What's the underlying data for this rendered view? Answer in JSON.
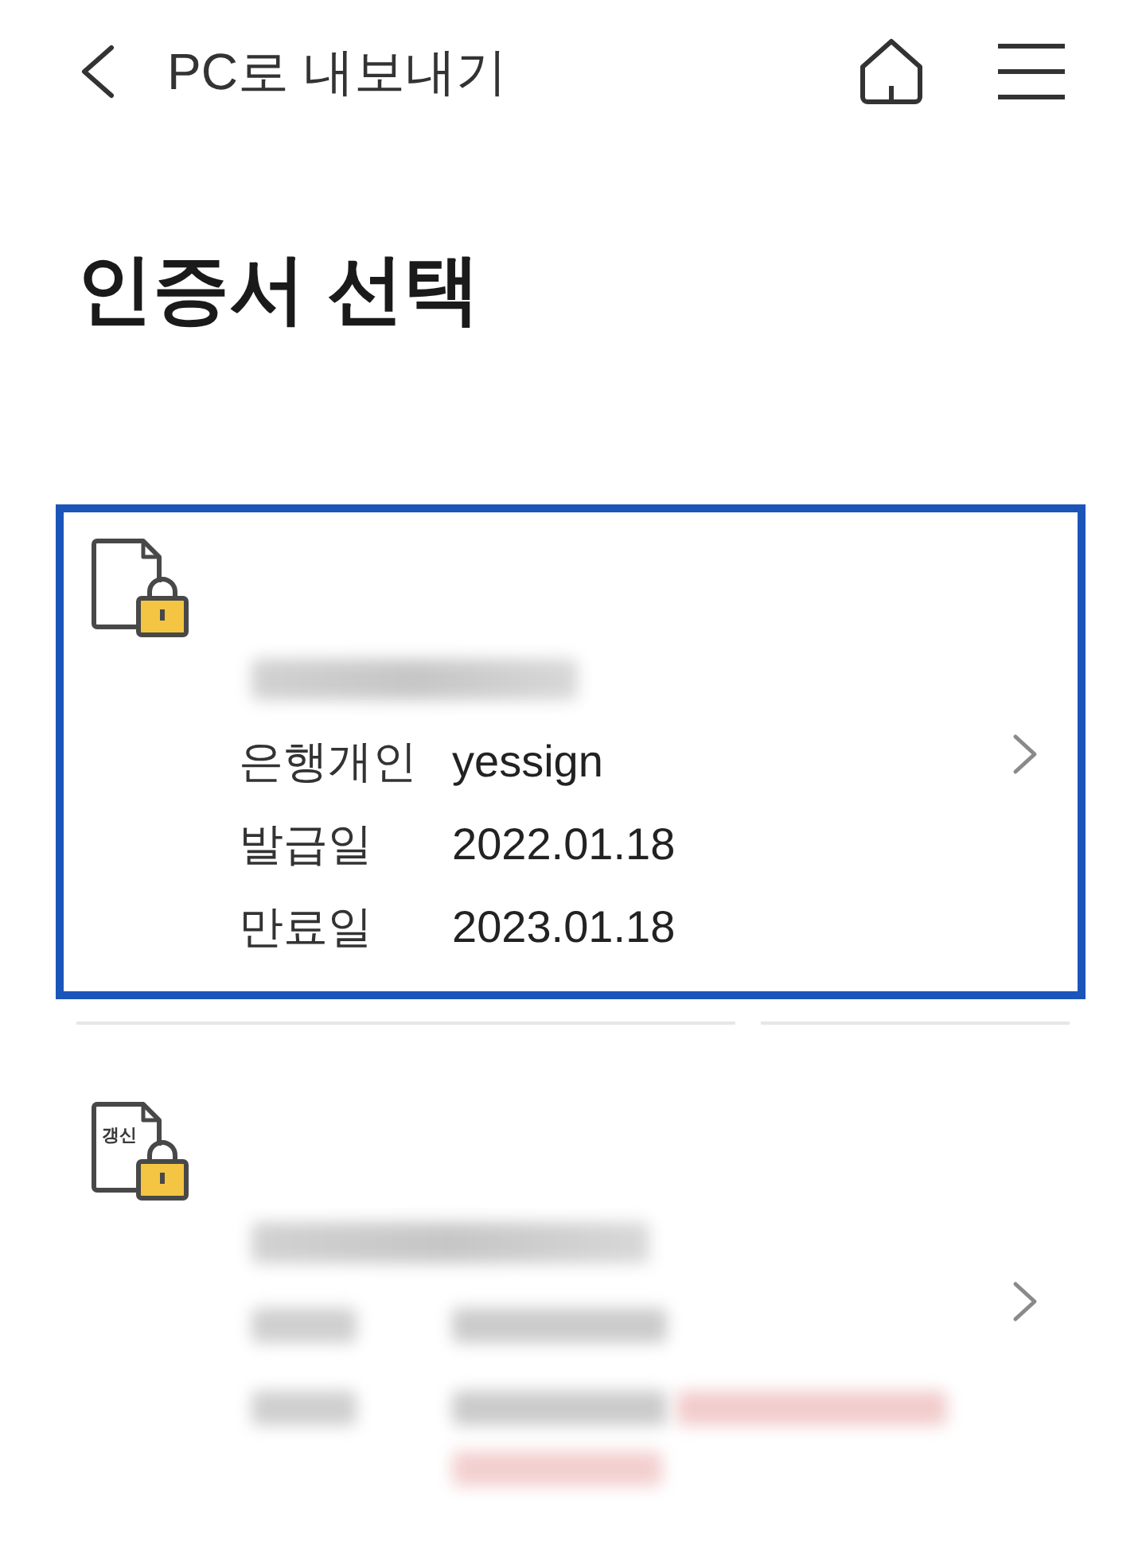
{
  "header": {
    "title": "PC로 내보내기"
  },
  "page_title": "인증서 선택",
  "cards": [
    {
      "selected": true,
      "name_redacted": true,
      "rows": [
        {
          "label": "은행개인",
          "value": "yessign",
          "redacted": false,
          "warning": false
        },
        {
          "label": "발급일",
          "value": "2022.01.18",
          "redacted": false,
          "warning": false
        },
        {
          "label": "만료일",
          "value": "2023.01.18",
          "redacted": false,
          "warning": false
        }
      ]
    },
    {
      "selected": false,
      "badge": "갱신",
      "name_redacted": true,
      "rows": [
        {
          "redacted": true,
          "warning": false
        },
        {
          "redacted": true,
          "warning": true
        }
      ]
    }
  ]
}
